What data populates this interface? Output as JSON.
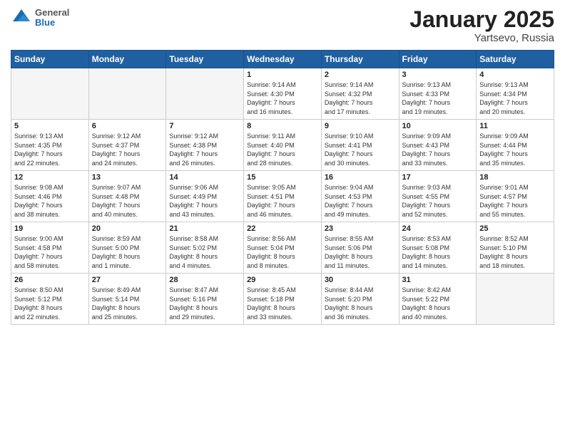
{
  "header": {
    "logo_general": "General",
    "logo_blue": "Blue",
    "month_title": "January 2025",
    "location": "Yartsevo, Russia"
  },
  "weekdays": [
    "Sunday",
    "Monday",
    "Tuesday",
    "Wednesday",
    "Thursday",
    "Friday",
    "Saturday"
  ],
  "weeks": [
    [
      {
        "day": "",
        "info": ""
      },
      {
        "day": "",
        "info": ""
      },
      {
        "day": "",
        "info": ""
      },
      {
        "day": "1",
        "info": "Sunrise: 9:14 AM\nSunset: 4:30 PM\nDaylight: 7 hours\nand 16 minutes."
      },
      {
        "day": "2",
        "info": "Sunrise: 9:14 AM\nSunset: 4:32 PM\nDaylight: 7 hours\nand 17 minutes."
      },
      {
        "day": "3",
        "info": "Sunrise: 9:13 AM\nSunset: 4:33 PM\nDaylight: 7 hours\nand 19 minutes."
      },
      {
        "day": "4",
        "info": "Sunrise: 9:13 AM\nSunset: 4:34 PM\nDaylight: 7 hours\nand 20 minutes."
      }
    ],
    [
      {
        "day": "5",
        "info": "Sunrise: 9:13 AM\nSunset: 4:35 PM\nDaylight: 7 hours\nand 22 minutes."
      },
      {
        "day": "6",
        "info": "Sunrise: 9:12 AM\nSunset: 4:37 PM\nDaylight: 7 hours\nand 24 minutes."
      },
      {
        "day": "7",
        "info": "Sunrise: 9:12 AM\nSunset: 4:38 PM\nDaylight: 7 hours\nand 26 minutes."
      },
      {
        "day": "8",
        "info": "Sunrise: 9:11 AM\nSunset: 4:40 PM\nDaylight: 7 hours\nand 28 minutes."
      },
      {
        "day": "9",
        "info": "Sunrise: 9:10 AM\nSunset: 4:41 PM\nDaylight: 7 hours\nand 30 minutes."
      },
      {
        "day": "10",
        "info": "Sunrise: 9:09 AM\nSunset: 4:43 PM\nDaylight: 7 hours\nand 33 minutes."
      },
      {
        "day": "11",
        "info": "Sunrise: 9:09 AM\nSunset: 4:44 PM\nDaylight: 7 hours\nand 35 minutes."
      }
    ],
    [
      {
        "day": "12",
        "info": "Sunrise: 9:08 AM\nSunset: 4:46 PM\nDaylight: 7 hours\nand 38 minutes."
      },
      {
        "day": "13",
        "info": "Sunrise: 9:07 AM\nSunset: 4:48 PM\nDaylight: 7 hours\nand 40 minutes."
      },
      {
        "day": "14",
        "info": "Sunrise: 9:06 AM\nSunset: 4:49 PM\nDaylight: 7 hours\nand 43 minutes."
      },
      {
        "day": "15",
        "info": "Sunrise: 9:05 AM\nSunset: 4:51 PM\nDaylight: 7 hours\nand 46 minutes."
      },
      {
        "day": "16",
        "info": "Sunrise: 9:04 AM\nSunset: 4:53 PM\nDaylight: 7 hours\nand 49 minutes."
      },
      {
        "day": "17",
        "info": "Sunrise: 9:03 AM\nSunset: 4:55 PM\nDaylight: 7 hours\nand 52 minutes."
      },
      {
        "day": "18",
        "info": "Sunrise: 9:01 AM\nSunset: 4:57 PM\nDaylight: 7 hours\nand 55 minutes."
      }
    ],
    [
      {
        "day": "19",
        "info": "Sunrise: 9:00 AM\nSunset: 4:58 PM\nDaylight: 7 hours\nand 58 minutes."
      },
      {
        "day": "20",
        "info": "Sunrise: 8:59 AM\nSunset: 5:00 PM\nDaylight: 8 hours\nand 1 minute."
      },
      {
        "day": "21",
        "info": "Sunrise: 8:58 AM\nSunset: 5:02 PM\nDaylight: 8 hours\nand 4 minutes."
      },
      {
        "day": "22",
        "info": "Sunrise: 8:56 AM\nSunset: 5:04 PM\nDaylight: 8 hours\nand 8 minutes."
      },
      {
        "day": "23",
        "info": "Sunrise: 8:55 AM\nSunset: 5:06 PM\nDaylight: 8 hours\nand 11 minutes."
      },
      {
        "day": "24",
        "info": "Sunrise: 8:53 AM\nSunset: 5:08 PM\nDaylight: 8 hours\nand 14 minutes."
      },
      {
        "day": "25",
        "info": "Sunrise: 8:52 AM\nSunset: 5:10 PM\nDaylight: 8 hours\nand 18 minutes."
      }
    ],
    [
      {
        "day": "26",
        "info": "Sunrise: 8:50 AM\nSunset: 5:12 PM\nDaylight: 8 hours\nand 22 minutes."
      },
      {
        "day": "27",
        "info": "Sunrise: 8:49 AM\nSunset: 5:14 PM\nDaylight: 8 hours\nand 25 minutes."
      },
      {
        "day": "28",
        "info": "Sunrise: 8:47 AM\nSunset: 5:16 PM\nDaylight: 8 hours\nand 29 minutes."
      },
      {
        "day": "29",
        "info": "Sunrise: 8:45 AM\nSunset: 5:18 PM\nDaylight: 8 hours\nand 33 minutes."
      },
      {
        "day": "30",
        "info": "Sunrise: 8:44 AM\nSunset: 5:20 PM\nDaylight: 8 hours\nand 36 minutes."
      },
      {
        "day": "31",
        "info": "Sunrise: 8:42 AM\nSunset: 5:22 PM\nDaylight: 8 hours\nand 40 minutes."
      },
      {
        "day": "",
        "info": ""
      }
    ]
  ]
}
